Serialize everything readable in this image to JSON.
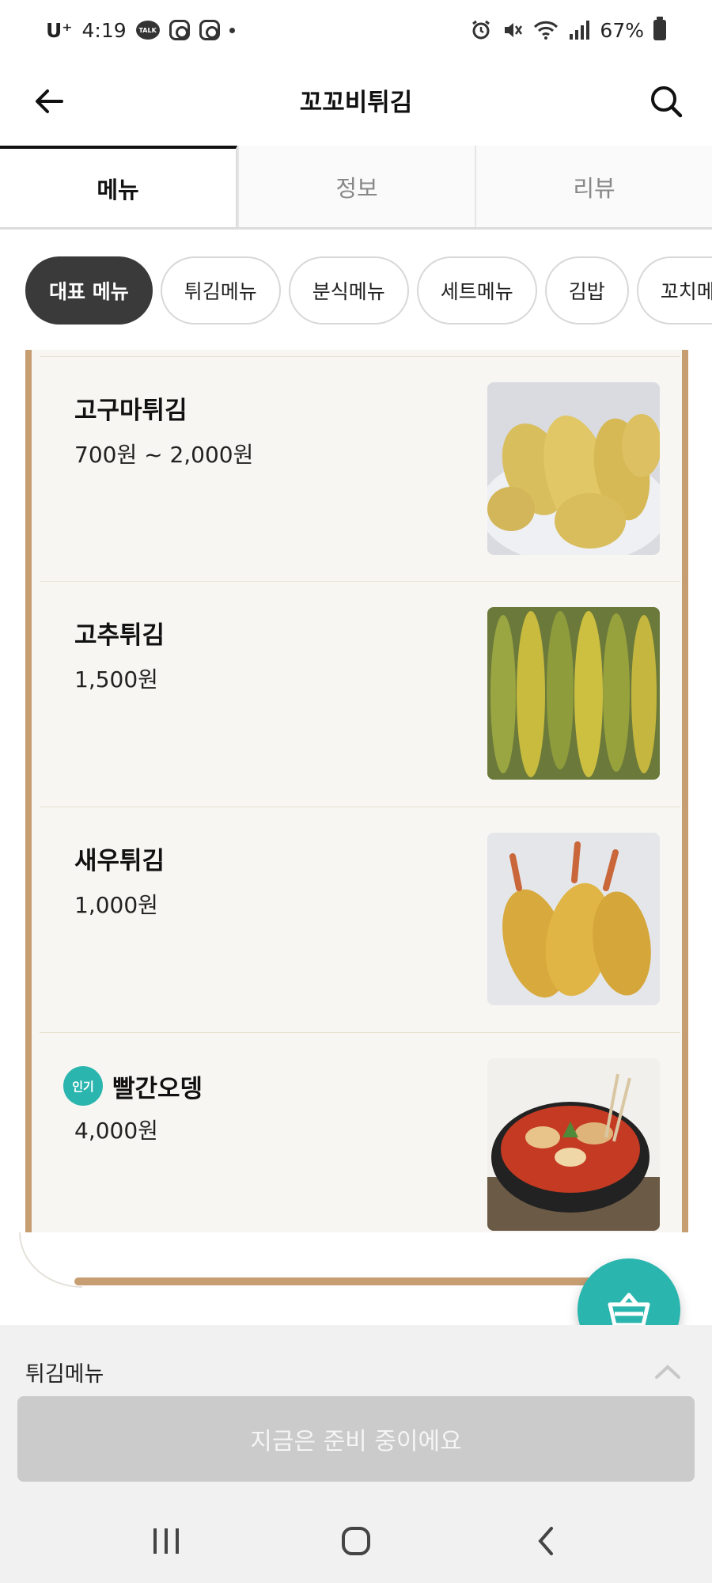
{
  "status_bar": {
    "carrier": "U⁺",
    "time": "4:19",
    "battery": "67%"
  },
  "header": {
    "title": "꼬꼬비튀김"
  },
  "tabs": [
    {
      "label": "메뉴",
      "active": true
    },
    {
      "label": "정보",
      "active": false
    },
    {
      "label": "리뷰",
      "active": false
    }
  ],
  "categories": [
    {
      "label": "대표 메뉴",
      "active": true
    },
    {
      "label": "튀김메뉴",
      "active": false
    },
    {
      "label": "분식메뉴",
      "active": false
    },
    {
      "label": "세트메뉴",
      "active": false
    },
    {
      "label": "김밥",
      "active": false
    },
    {
      "label": "꼬치메뉴",
      "active": false
    }
  ],
  "menu_items": [
    {
      "name": "고구마튀김",
      "price": "700원 ~ 2,000원",
      "badge": ""
    },
    {
      "name": "고추튀김",
      "price": "1,500원",
      "badge": ""
    },
    {
      "name": "새우튀김",
      "price": "1,000원",
      "badge": ""
    },
    {
      "name": "빨간오뎅",
      "price": "4,000원",
      "badge": "인기"
    }
  ],
  "bottom_panel": {
    "section_label": "튀김메뉴",
    "action_label": "지금은 준비 중이에요"
  },
  "colors": {
    "accent": "#2ab5ae",
    "board_frame": "#c79e72",
    "chip_active": "#3a3a3a"
  },
  "icons": {
    "back": "arrow-left-icon",
    "search": "search-icon",
    "cart": "basket-icon",
    "collapse": "chevron-up-icon"
  }
}
